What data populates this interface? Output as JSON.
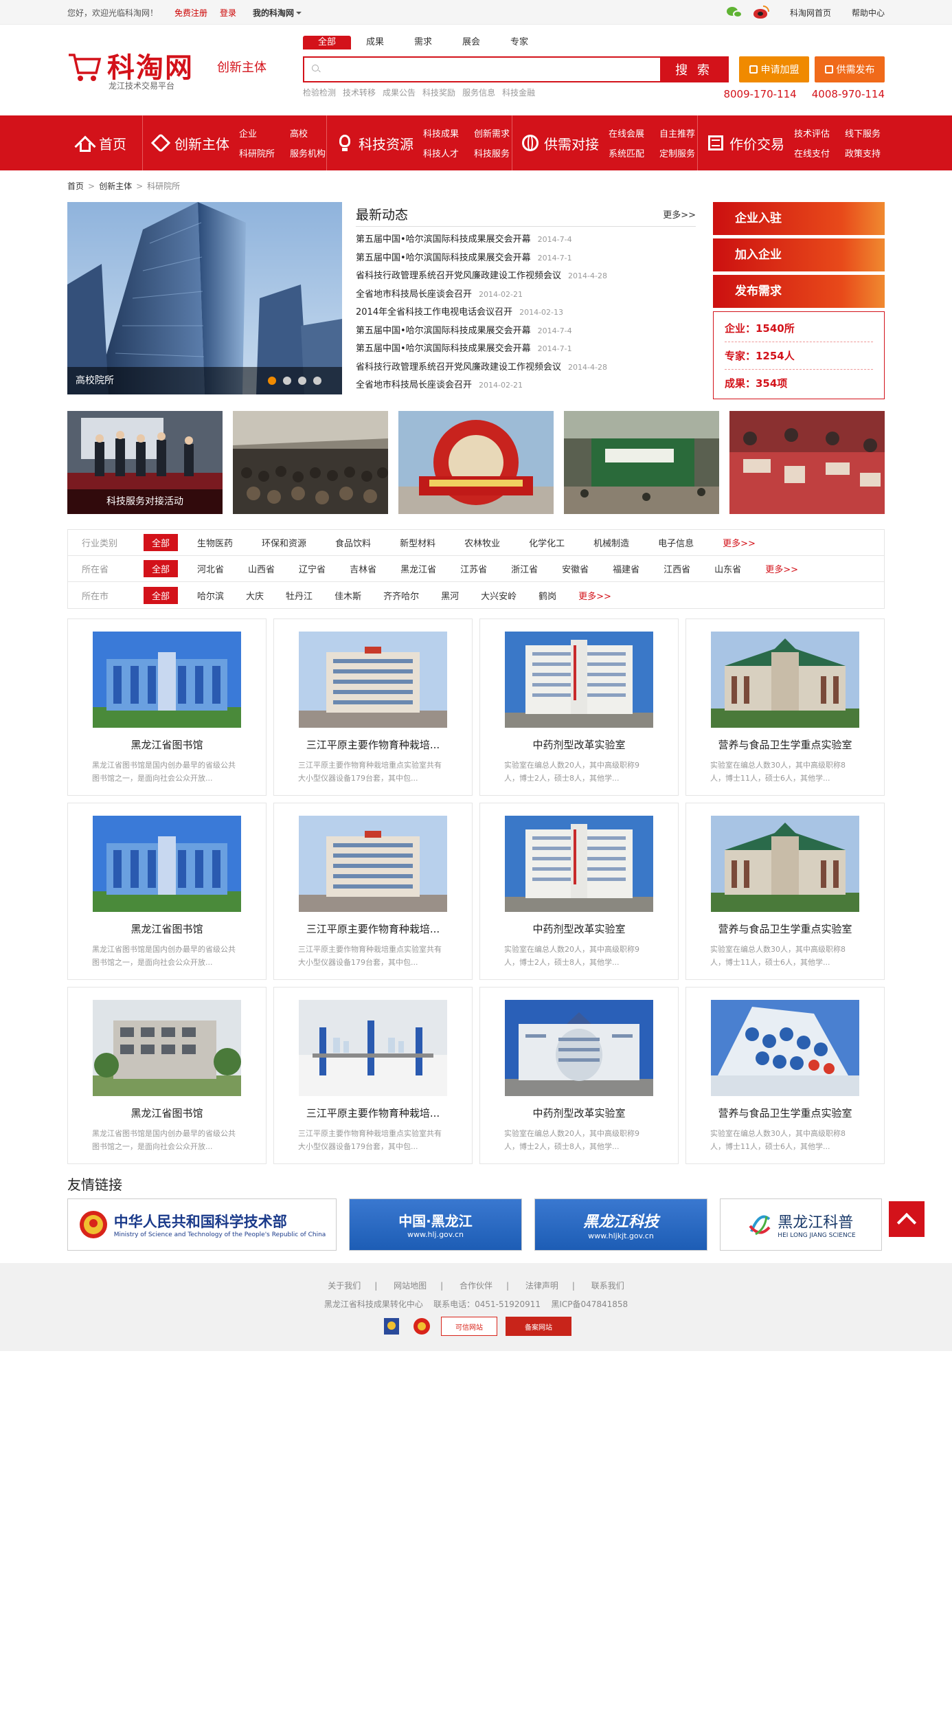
{
  "topbar": {
    "welcome": "您好，欢迎光临科淘网！",
    "register": "免费注册",
    "login": "登录",
    "my": "我的科淘网",
    "home_link": "科淘网首页",
    "help": "帮助中心"
  },
  "header": {
    "logo": "科淘网",
    "logo_sub": "龙江技术交易平台",
    "section": "创新主体",
    "search_tabs": [
      "全部",
      "成果",
      "需求",
      "展会",
      "专家"
    ],
    "search_placeholder": "",
    "search_button": "搜 索",
    "hotwords": [
      "检验检测",
      "技术转移",
      "成果公告",
      "科技奖励",
      "服务信息",
      "科技金融"
    ],
    "btn_join": "申请加盟",
    "btn_publish": "供需发布",
    "phone1": "8009-170-114",
    "phone2": "4008-970-114"
  },
  "nav": {
    "home": "首页",
    "g1": {
      "title": "创新主体",
      "subs": [
        "企业",
        "高校",
        "科研院所",
        "服务机构"
      ]
    },
    "g2": {
      "title": "科技资源",
      "subs": [
        "科技成果",
        "创新需求",
        "科技人才",
        "科技服务"
      ]
    },
    "g3": {
      "title": "供需对接",
      "subs": [
        "在线会展",
        "自主推荐",
        "系统匹配",
        "定制服务"
      ]
    },
    "g4": {
      "title": "作价交易",
      "subs": [
        "技术评估",
        "线下服务",
        "在线支付",
        "政策支持"
      ]
    }
  },
  "breadcrumb": [
    "首页",
    "创新主体",
    "科研院所"
  ],
  "slider": {
    "caption": "高校院所"
  },
  "news": {
    "title": "最新动态",
    "more": "更多>>",
    "items": [
      {
        "t": "第五届中国•哈尔滨国际科技成果展交会开幕",
        "d": "2014-7-4"
      },
      {
        "t": "第五届中国•哈尔滨国际科技成果展交会开幕",
        "d": "2014-7-1"
      },
      {
        "t": "省科技行政管理系统召开党风廉政建设工作视频会议",
        "d": "2014-4-28"
      },
      {
        "t": "全省地市科技局长座谈会召开",
        "d": "2014-02-21"
      },
      {
        "t": "2014年全省科技工作电视电话会议召开",
        "d": "2014-02-13"
      },
      {
        "t": "第五届中国•哈尔滨国际科技成果展交会开幕",
        "d": "2014-7-4"
      },
      {
        "t": "第五届中国•哈尔滨国际科技成果展交会开幕",
        "d": "2014-7-1"
      },
      {
        "t": "省科技行政管理系统召开党风廉政建设工作视频会议",
        "d": "2014-4-28"
      },
      {
        "t": "全省地市科技局长座谈会召开",
        "d": "2014-02-21"
      }
    ]
  },
  "side": {
    "btn1": "企业入驻",
    "btn2": "加入企业",
    "btn3": "发布需求",
    "stat1": "企业：1540所",
    "stat2": "专家：1254人",
    "stat3": "成果：354项"
  },
  "photos": {
    "caption1": "科技服务对接活动"
  },
  "filter": {
    "row1": {
      "label": "行业类别",
      "all": "全部",
      "opts": [
        "生物医药",
        "环保和资源",
        "食品饮料",
        "新型材料",
        "农林牧业",
        "化学化工",
        "机械制造",
        "电子信息"
      ],
      "more": "更多>>"
    },
    "row2": {
      "label": "所在省",
      "all": "全部",
      "opts": [
        "河北省",
        "山西省",
        "辽宁省",
        "吉林省",
        "黑龙江省",
        "江苏省",
        "浙江省",
        "安徽省",
        "福建省",
        "江西省",
        "山东省"
      ],
      "more": "更多>>"
    },
    "row3": {
      "label": "所在市",
      "all": "全部",
      "opts": [
        "哈尔滨",
        "大庆",
        "牡丹江",
        "佳木斯",
        "齐齐哈尔",
        "黑河",
        "大兴安岭",
        "鹤岗"
      ],
      "more": "更多>>"
    }
  },
  "cards": [
    {
      "title": "黑龙江省图书馆",
      "desc": "黑龙江省图书馆是国内创办最早的省级公共图书馆之一，是面向社会公众开放..."
    },
    {
      "title": "三江平原主要作物育种栽培...",
      "desc": "三江平原主要作物育种栽培重点实验室共有大小型仪器设备179台套，其中包..."
    },
    {
      "title": "中药剂型改革实验室",
      "desc": "实验室在编总人数20人，其中高级职称9人，博士2人，硕士8人，其他学..."
    },
    {
      "title": "营养与食品卫生学重点实验室",
      "desc": "实验室在编总人数30人，其中高级职称8人，博士11人，硕士6人，其他学..."
    },
    {
      "title": "黑龙江省图书馆",
      "desc": "黑龙江省图书馆是国内创办最早的省级公共图书馆之一，是面向社会公众开放..."
    },
    {
      "title": "三江平原主要作物育种栽培...",
      "desc": "三江平原主要作物育种栽培重点实验室共有大小型仪器设备179台套，其中包..."
    },
    {
      "title": "中药剂型改革实验室",
      "desc": "实验室在编总人数20人，其中高级职称9人，博士2人，硕士8人，其他学..."
    },
    {
      "title": "营养与食品卫生学重点实验室",
      "desc": "实验室在编总人数30人，其中高级职称8人，博士11人，硕士6人，其他学..."
    },
    {
      "title": "黑龙江省图书馆",
      "desc": "黑龙江省图书馆是国内创办最早的省级公共图书馆之一，是面向社会公众开放..."
    },
    {
      "title": "三江平原主要作物育种栽培...",
      "desc": "三江平原主要作物育种栽培重点实验室共有大小型仪器设备179台套，其中包..."
    },
    {
      "title": "中药剂型改革实验室",
      "desc": "实验室在编总人数20人，其中高级职称9人，博士2人，硕士8人，其他学..."
    },
    {
      "title": "营养与食品卫生学重点实验室",
      "desc": "实验室在编总人数30人，其中高级职称8人，博士11人，硕士6人，其他学..."
    }
  ],
  "links": {
    "title": "友情链接",
    "l1": "中华人民共和国科学技术部",
    "l1_en": "Ministry of Science and Technology of the People's Republic of China",
    "l2": "中国·黑龙江",
    "l2_url": "www.hlj.gov.cn",
    "l3": "黑龙江科技",
    "l3_url": "www.hljkjt.gov.cn",
    "l4": "黑龙江科普",
    "l4_en": "HEI LONG JIANG SCIENCE"
  },
  "footer": {
    "links": [
      "关于我们",
      "网站地图",
      "合作伙伴",
      "法律声明",
      "联系我们"
    ],
    "org": "黑龙江省科技成果转化中心",
    "tel": "联系电话：0451-51920911",
    "icp": "黑ICP备047841858",
    "badge1": "可信网站",
    "badge2": "备案网站"
  },
  "colors": {
    "brand": "#d3121a",
    "accent": "#f08a00"
  }
}
